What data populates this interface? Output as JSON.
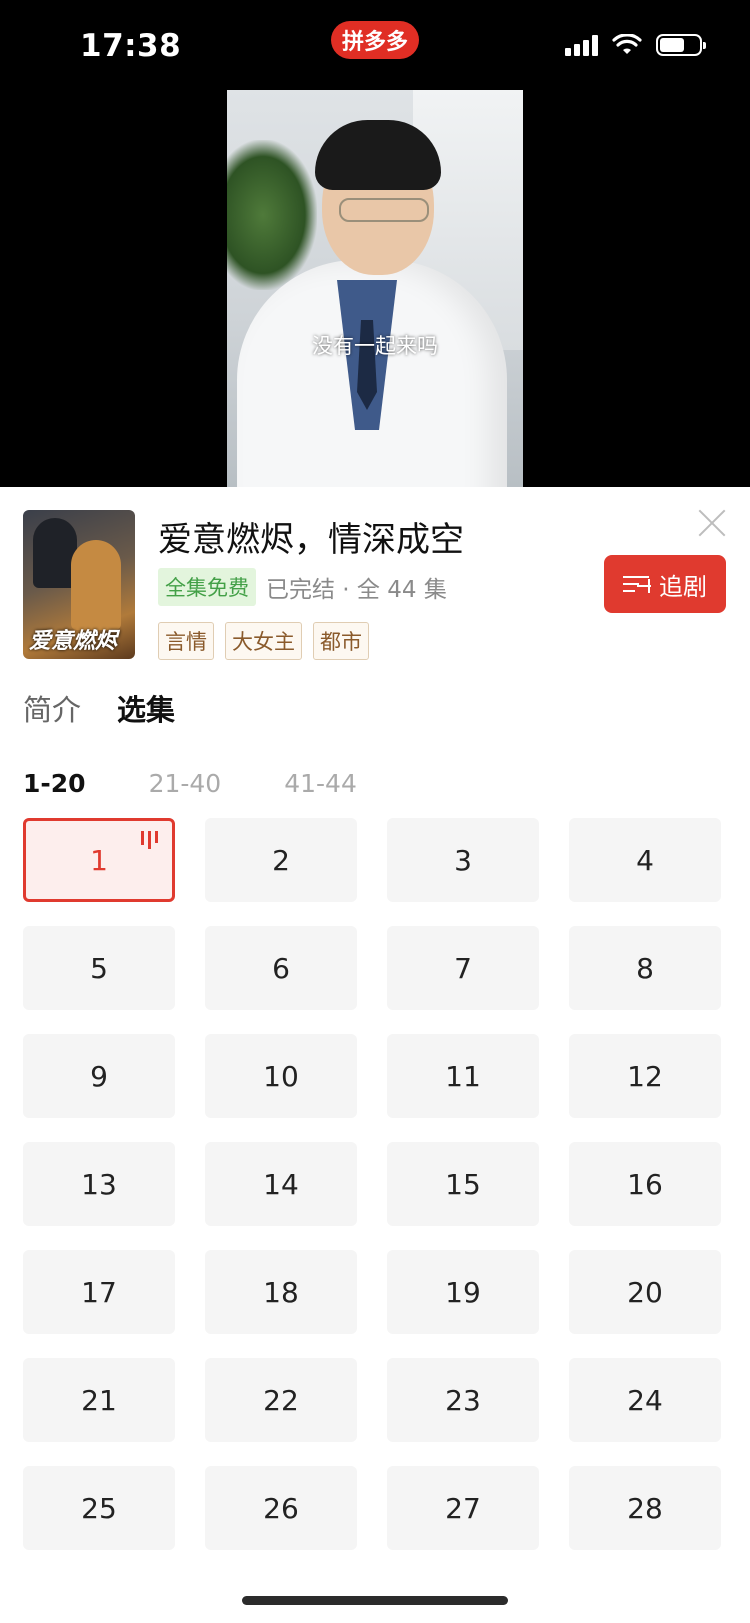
{
  "status_bar": {
    "time": "17:38",
    "app_badge": "拼多多"
  },
  "video": {
    "subtitle": "没有一起来吗"
  },
  "drama": {
    "title": "爱意燃烬，情深成空",
    "free_tag": "全集免费",
    "status": "已完结 · 全 44 集",
    "genres": [
      "言情",
      "大女主",
      "都市"
    ],
    "poster_text": "爱意燃烬"
  },
  "follow_button": {
    "label": "追剧"
  },
  "tabs": [
    {
      "label": "简介",
      "active": false
    },
    {
      "label": "选集",
      "active": true
    }
  ],
  "ranges": [
    {
      "label": "1-20",
      "active": true
    },
    {
      "label": "21-40",
      "active": false
    },
    {
      "label": "41-44",
      "active": false
    }
  ],
  "episodes": [
    "1",
    "2",
    "3",
    "4",
    "5",
    "6",
    "7",
    "8",
    "9",
    "10",
    "11",
    "12",
    "13",
    "14",
    "15",
    "16",
    "17",
    "18",
    "19",
    "20",
    "21",
    "22",
    "23",
    "24",
    "25",
    "26",
    "27",
    "28"
  ],
  "current_episode": "1",
  "colors": {
    "accent": "#e03a2f",
    "free_green": "#43a047",
    "tag_brown": "#8a5a2b"
  }
}
